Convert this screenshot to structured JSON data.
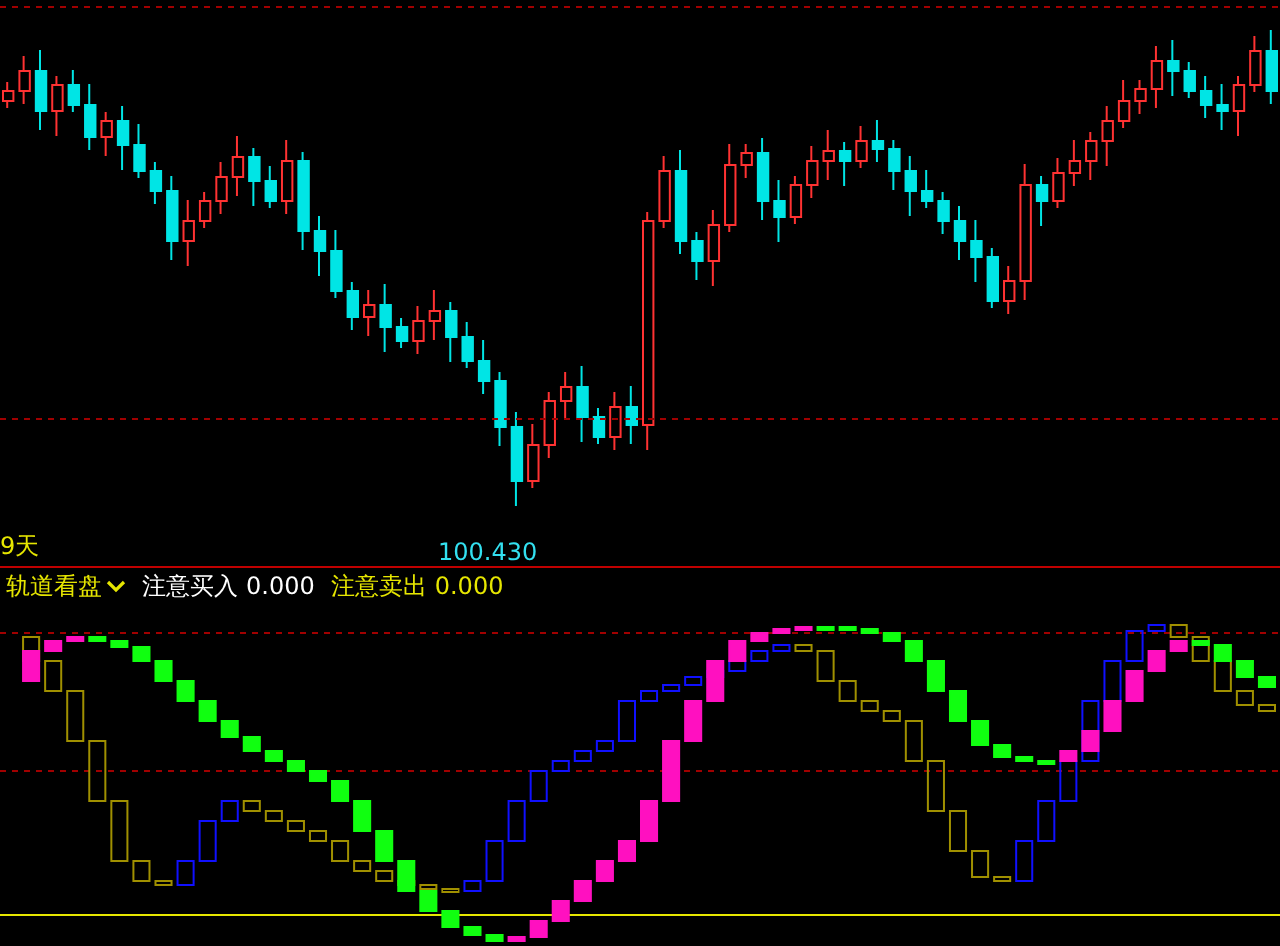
{
  "price_panel": {
    "period_label": "9天",
    "low_price_label": "100.430"
  },
  "indicator_panel": {
    "name": "轨道看盘",
    "readings": [
      {
        "label": "注意买入",
        "value": "0.000",
        "color": "#ffffff"
      },
      {
        "label": "注意卖出",
        "value": "0.000",
        "color": "#e6e600"
      }
    ]
  }
}
